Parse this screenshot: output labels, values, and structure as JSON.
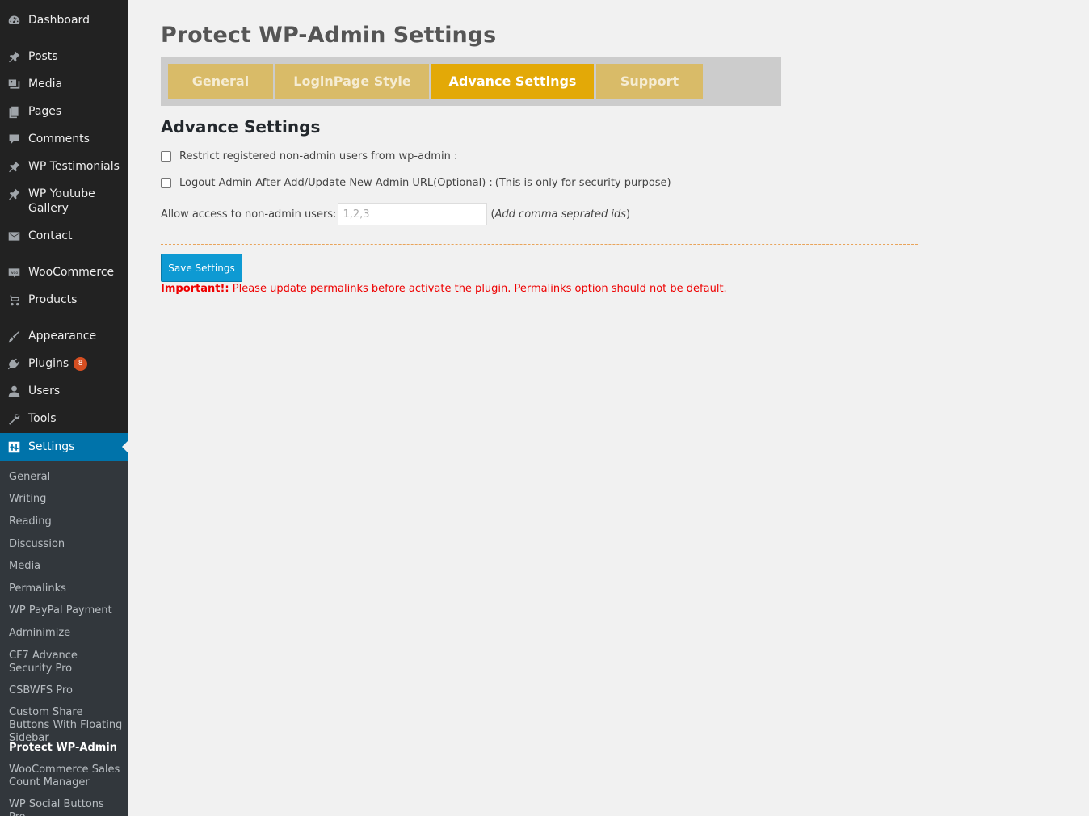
{
  "sidebar": {
    "items": [
      {
        "label": "Dashboard",
        "icon": "dashboard-icon"
      },
      {
        "label": "Posts",
        "icon": "pin-icon"
      },
      {
        "label": "Media",
        "icon": "media-icon"
      },
      {
        "label": "Pages",
        "icon": "pages-icon"
      },
      {
        "label": "Comments",
        "icon": "comment-icon"
      },
      {
        "label": "WP Testimonials",
        "icon": "pin-icon"
      },
      {
        "label": "WP Youtube Gallery",
        "icon": "pin-icon"
      },
      {
        "label": "Contact",
        "icon": "mail-icon"
      },
      {
        "label": "WooCommerce",
        "icon": "woo-icon"
      },
      {
        "label": "Products",
        "icon": "cart-icon"
      },
      {
        "label": "Appearance",
        "icon": "brush-icon"
      },
      {
        "label": "Plugins",
        "icon": "plugin-icon",
        "badge": "8"
      },
      {
        "label": "Users",
        "icon": "user-icon"
      },
      {
        "label": "Tools",
        "icon": "wrench-icon"
      },
      {
        "label": "Settings",
        "icon": "settings-icon"
      }
    ],
    "submenu": [
      "General",
      "Writing",
      "Reading",
      "Discussion",
      "Media",
      "Permalinks",
      "WP PayPal Payment",
      "Adminimize",
      "CF7 Advance Security Pro",
      "CSBWFS Pro",
      "Custom Share Buttons With Floating Sidebar",
      "Protect WP-Admin",
      "WooCommerce Sales Count Manager",
      "WP Social Buttons Pro"
    ]
  },
  "main": {
    "title": "Protect WP-Admin Settings",
    "tabs": [
      "General",
      "LoginPage Style",
      "Advance Settings",
      "Support"
    ],
    "active_tab": "Advance Settings",
    "section_title": "Advance Settings",
    "option1_label": "Restrict registered non-admin users from wp-admin :",
    "option2_label": "Logout Admin After Add/Update New Admin URL(Optional) :",
    "option2_note": "(This is only for security purpose)",
    "allow_label": "Allow access to non-admin users:",
    "allow_placeholder": "1,2,3",
    "allow_hint": "Add comma seprated ids",
    "save_label": "Save Settings",
    "notice_strong": "Important!:",
    "notice_text": "Please update permalinks before activate the plugin. Permalinks option should not be default."
  },
  "colors": {
    "sidebar_bg": "#222222",
    "submenu_bg": "#32373c",
    "active_menu": "#0073aa",
    "tab_bg": "#d9bb68",
    "tab_active": "#e3a907",
    "button": "#0e9ad3",
    "notice": "#ee0000"
  }
}
